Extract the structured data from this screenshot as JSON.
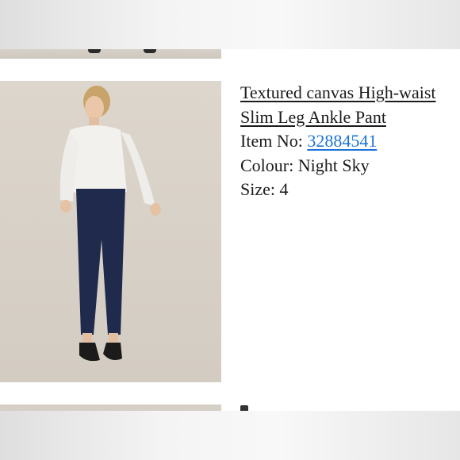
{
  "product": {
    "title": "Textured canvas High-waist Slim Leg Ankle Pant",
    "item_no_label": "Item No:",
    "item_no": "32884541",
    "colour_label": "Colour:",
    "colour": "Night Sky",
    "size_label": "Size:",
    "size": "4"
  },
  "colors": {
    "link": "#1a74d6",
    "pants": "#1f2a4d",
    "blouse": "#f3f1ee",
    "background": "#d7d0c6"
  }
}
